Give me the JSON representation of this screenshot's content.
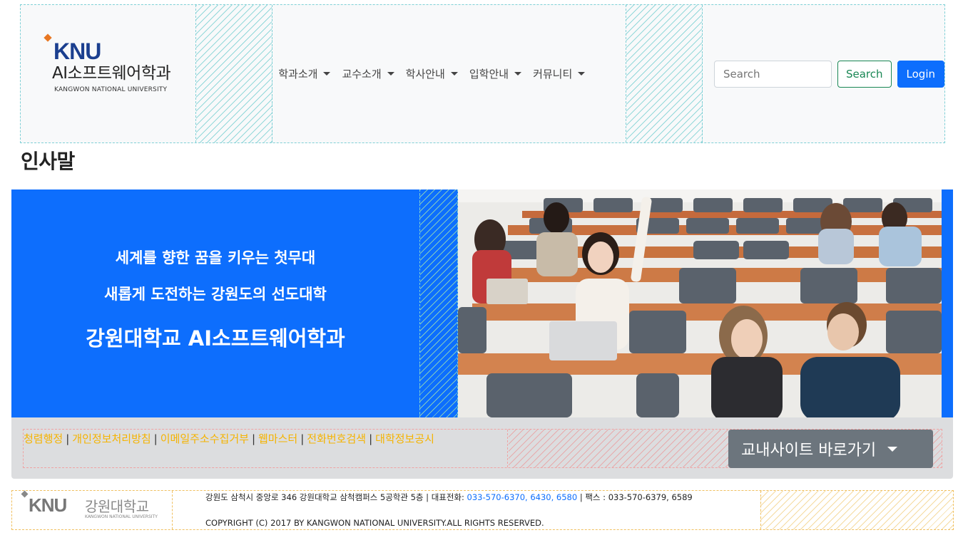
{
  "brand": {
    "logo_text": "KNU",
    "dept_name": "AI소프트웨어학과",
    "univ_name": "KANGWON NATIONAL UNIVERSITY"
  },
  "nav": {
    "items": [
      {
        "label": "학과소개"
      },
      {
        "label": "교수소개"
      },
      {
        "label": "학사안내"
      },
      {
        "label": "입학안내"
      },
      {
        "label": "커뮤니티"
      }
    ]
  },
  "search": {
    "placeholder": "Search",
    "button_label": "Search"
  },
  "login_label": "Login",
  "page_title": "인사말",
  "hero": {
    "line1": "세계를 향한 꿈을 키우는 첫무대",
    "line2": "새롭게 도전하는 강원도의 선도대학",
    "line3": "강원대학교 AI소프트웨어학과",
    "accent_color": "#0d6efd"
  },
  "links": {
    "items": [
      "청렴행정",
      "개인정보처리방침",
      "이메일주소수집거부",
      "웹마스터",
      "전화번호검색",
      "대학정보공시"
    ],
    "separator": "|",
    "link_color": "#f5b300"
  },
  "site_button_label": "교내사이트 바로가기",
  "footer": {
    "logo_text": "KNU",
    "logo_korean": "강원대학교",
    "logo_english": "KANGWON NATIONAL UNIVERSITY",
    "address_prefix": "강원도 삼척시 중앙로 346 강원대학교 삼척캠퍼스 5공학관 5층 | 대표전화: ",
    "phone": "033-570-6370, 6430, 6580",
    "fax": " | 팩스 : 033-570-6379, 6589",
    "copyright": "COPYRIGHT (C) 2017 BY KANGWON NATIONAL UNIVERSITY.ALL RIGHTS RESERVED."
  }
}
